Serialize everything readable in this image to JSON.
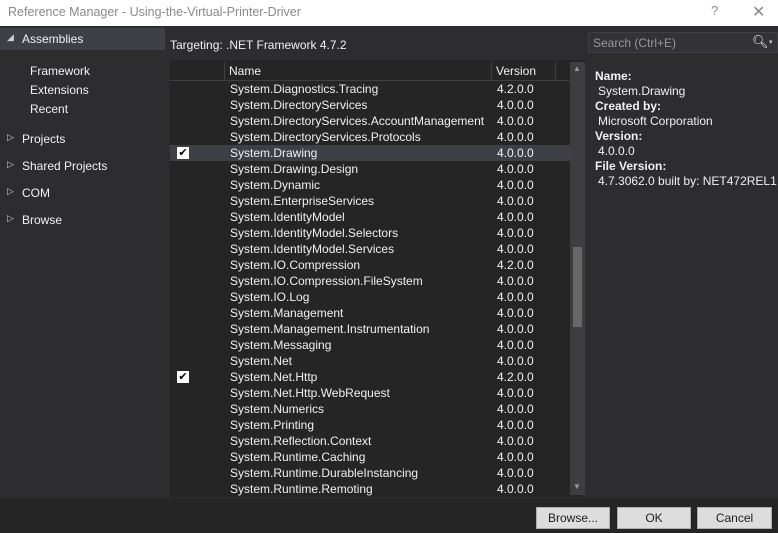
{
  "window": {
    "title": "Reference Manager - Using-the-Virtual-Printer-Driver",
    "help_label": "?",
    "close_label": "✕"
  },
  "sidebar": {
    "assemblies": {
      "label": "Assemblies",
      "expanded": true,
      "arrow": "◢"
    },
    "sub_items": [
      "Framework",
      "Extensions",
      "Recent"
    ],
    "groups": [
      {
        "label": "Projects",
        "arrow": "▷"
      },
      {
        "label": "Shared Projects",
        "arrow": "▷"
      },
      {
        "label": "COM",
        "arrow": "▷"
      },
      {
        "label": "Browse",
        "arrow": "▷"
      }
    ]
  },
  "targeting": {
    "label": "Targeting: .NET Framework 4.7.2"
  },
  "search": {
    "placeholder": "Search (Ctrl+E)",
    "value": "",
    "icon": "search-icon",
    "dropdown_icon": "▾"
  },
  "grid": {
    "columns": {
      "name": "Name",
      "version": "Version"
    },
    "rows": [
      {
        "name": "System.Diagnostics.Tracing",
        "version": "4.2.0.0",
        "checked": false
      },
      {
        "name": "System.DirectoryServices",
        "version": "4.0.0.0",
        "checked": false
      },
      {
        "name": "System.DirectoryServices.AccountManagement",
        "version": "4.0.0.0",
        "checked": false
      },
      {
        "name": "System.DirectoryServices.Protocols",
        "version": "4.0.0.0",
        "checked": false
      },
      {
        "name": "System.Drawing",
        "version": "4.0.0.0",
        "checked": true,
        "selected": true
      },
      {
        "name": "System.Drawing.Design",
        "version": "4.0.0.0",
        "checked": false
      },
      {
        "name": "System.Dynamic",
        "version": "4.0.0.0",
        "checked": false
      },
      {
        "name": "System.EnterpriseServices",
        "version": "4.0.0.0",
        "checked": false
      },
      {
        "name": "System.IdentityModel",
        "version": "4.0.0.0",
        "checked": false
      },
      {
        "name": "System.IdentityModel.Selectors",
        "version": "4.0.0.0",
        "checked": false
      },
      {
        "name": "System.IdentityModel.Services",
        "version": "4.0.0.0",
        "checked": false
      },
      {
        "name": "System.IO.Compression",
        "version": "4.2.0.0",
        "checked": false
      },
      {
        "name": "System.IO.Compression.FileSystem",
        "version": "4.0.0.0",
        "checked": false
      },
      {
        "name": "System.IO.Log",
        "version": "4.0.0.0",
        "checked": false
      },
      {
        "name": "System.Management",
        "version": "4.0.0.0",
        "checked": false
      },
      {
        "name": "System.Management.Instrumentation",
        "version": "4.0.0.0",
        "checked": false
      },
      {
        "name": "System.Messaging",
        "version": "4.0.0.0",
        "checked": false
      },
      {
        "name": "System.Net",
        "version": "4.0.0.0",
        "checked": false
      },
      {
        "name": "System.Net.Http",
        "version": "4.2.0.0",
        "checked": true
      },
      {
        "name": "System.Net.Http.WebRequest",
        "version": "4.0.0.0",
        "checked": false
      },
      {
        "name": "System.Numerics",
        "version": "4.0.0.0",
        "checked": false
      },
      {
        "name": "System.Printing",
        "version": "4.0.0.0",
        "checked": false
      },
      {
        "name": "System.Reflection.Context",
        "version": "4.0.0.0",
        "checked": false
      },
      {
        "name": "System.Runtime.Caching",
        "version": "4.0.0.0",
        "checked": false
      },
      {
        "name": "System.Runtime.DurableInstancing",
        "version": "4.0.0.0",
        "checked": false
      },
      {
        "name": "System.Runtime.Remoting",
        "version": "4.0.0.0",
        "checked": false
      }
    ],
    "check_glyph": "✔",
    "scroll_up": "▲",
    "scroll_down": "▼"
  },
  "details": {
    "name_label": "Name:",
    "name_value": "System.Drawing",
    "created_label": "Created by:",
    "created_value": "Microsoft Corporation",
    "version_label": "Version:",
    "version_value": "4.0.0.0",
    "file_version_label": "File Version:",
    "file_version_value": "4.7.3062.0 built by: NET472REL1"
  },
  "footer": {
    "browse_label": "Browse...",
    "ok_label": "OK",
    "cancel_label": "Cancel"
  }
}
